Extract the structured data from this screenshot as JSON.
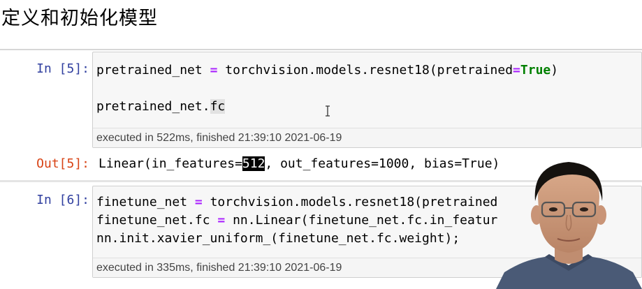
{
  "heading": "定义和初始化模型",
  "cells": [
    {
      "prompt": "In [5]:",
      "code": {
        "line1": {
          "a": "pretrained_net ",
          "op": "=",
          "b": " torchvision.models.resnet18(pretrained",
          "op2": "=",
          "kw": "True",
          "c": ")"
        },
        "line2": {
          "a": "pretrained_net.",
          "attr": "fc"
        }
      },
      "exec_info": "executed in 522ms, finished 21:39:10 2021-06-19"
    },
    {
      "prompt": "In [6]:",
      "code": {
        "line1": {
          "a": "finetune_net ",
          "op": "=",
          "b": " torchvision.models.resnet18(pretrained"
        },
        "line2": {
          "a": "finetune_net.fc ",
          "op": "=",
          "b": " nn.Linear(finetune_net.fc.in_featur"
        },
        "line3": "nn.init.xavier_uniform_(finetune_net.fc.weight);"
      },
      "exec_info": "executed in 335ms, finished 21:39:10 2021-06-19"
    }
  ],
  "output": {
    "prompt": "Out[5]:",
    "pre": "Linear(in_features=",
    "selected": "512",
    "post": ", out_features=1000, bias=True)"
  },
  "icons": {
    "text_cursor": "ibeam-cursor-icon",
    "webcam": "presenter-webcam"
  }
}
